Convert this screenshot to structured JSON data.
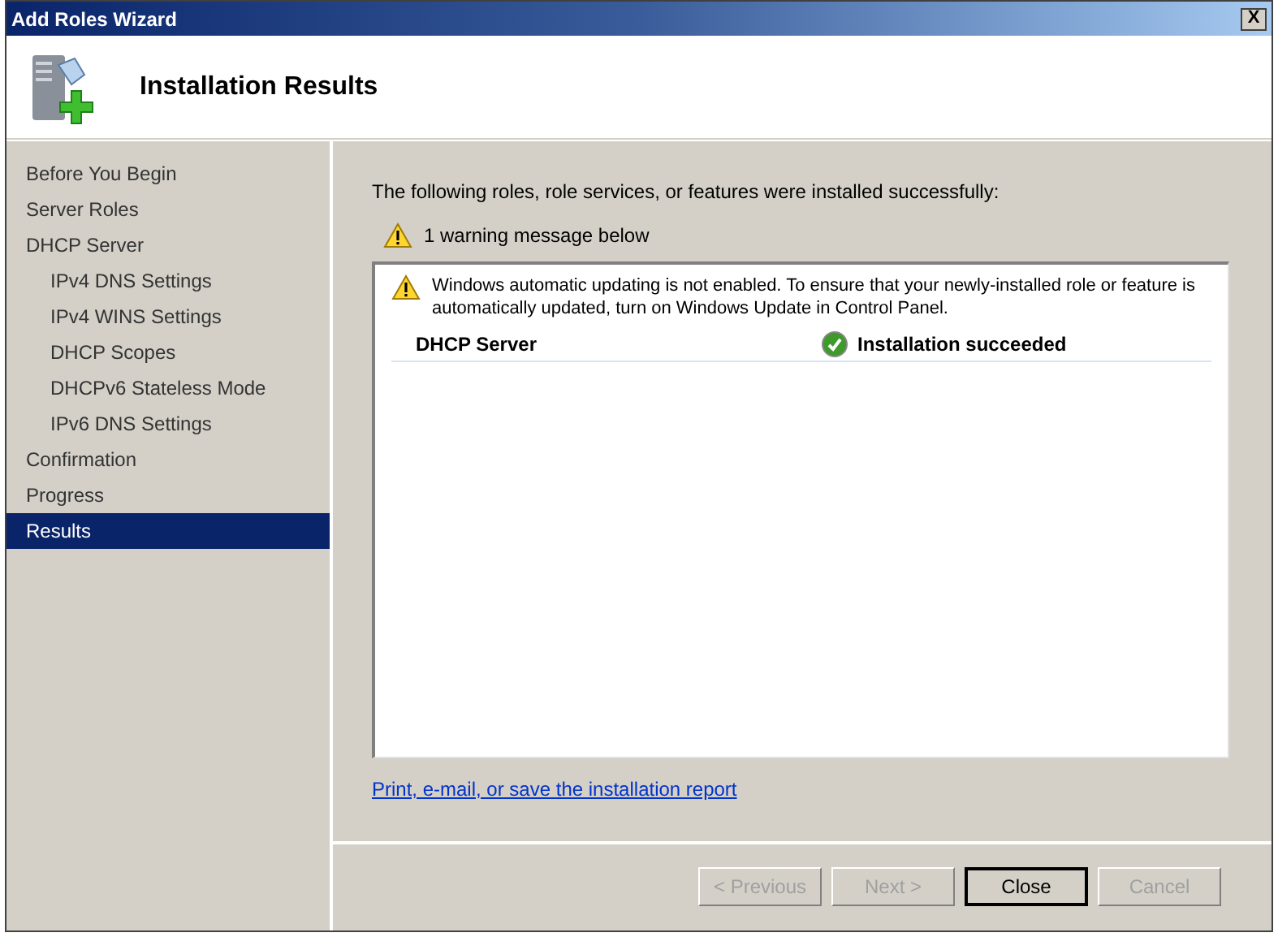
{
  "window": {
    "title": "Add Roles Wizard",
    "close_glyph": "X"
  },
  "header": {
    "title": "Installation Results"
  },
  "sidebar": {
    "items": [
      {
        "label": "Before You Begin",
        "selected": false
      },
      {
        "label": "Server Roles",
        "selected": false
      },
      {
        "label": "DHCP Server",
        "selected": false,
        "children": [
          {
            "label": "IPv4 DNS Settings",
            "selected": false
          },
          {
            "label": "IPv4 WINS Settings",
            "selected": false
          },
          {
            "label": "DHCP Scopes",
            "selected": false
          },
          {
            "label": "DHCPv6 Stateless Mode",
            "selected": false
          },
          {
            "label": "IPv6 DNS Settings",
            "selected": false
          }
        ]
      },
      {
        "label": "Confirmation",
        "selected": false
      },
      {
        "label": "Progress",
        "selected": false
      },
      {
        "label": "Results",
        "selected": true
      }
    ]
  },
  "content": {
    "intro": "The following roles, role services, or features were installed successfully:",
    "warning_summary": "1 warning message below",
    "results": {
      "warning": "Windows automatic updating is not enabled. To ensure that your newly-installed role or feature is automatically updated, turn on Windows Update in Control Panel.",
      "rows": [
        {
          "name": "DHCP Server",
          "status": "Installation succeeded",
          "kind": "success"
        }
      ]
    },
    "report_link": "Print, e-mail, or save the installation report"
  },
  "buttons": [
    {
      "label": "< Previous",
      "disabled": true,
      "default": false
    },
    {
      "label": "Next >",
      "disabled": true,
      "default": false
    },
    {
      "label": "Close",
      "disabled": false,
      "default": true
    },
    {
      "label": "Cancel",
      "disabled": true,
      "default": false
    }
  ]
}
